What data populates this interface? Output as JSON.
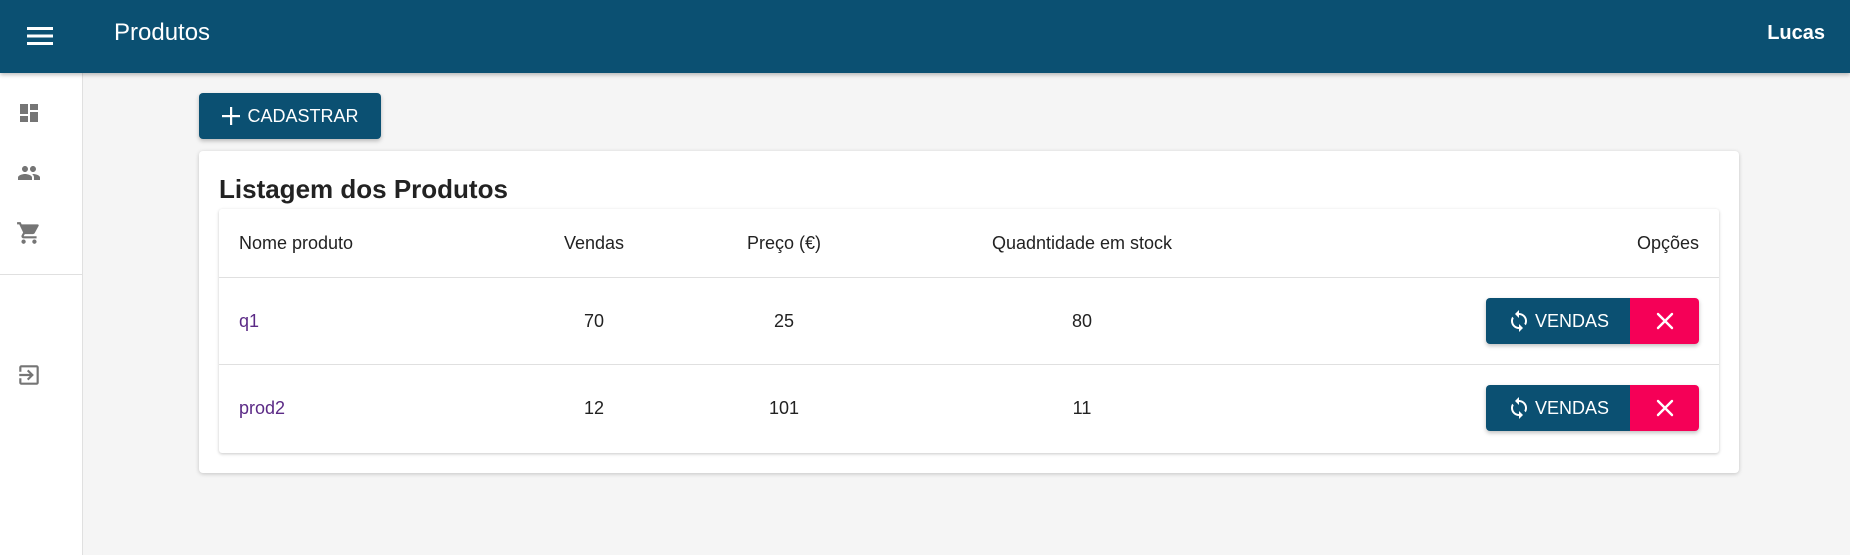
{
  "appbar": {
    "title": "Produtos",
    "user": "Lucas",
    "menu_icon": "menu-icon",
    "color": "#0b5072"
  },
  "sidebar": {
    "items": [
      {
        "icon": "dashboard-icon"
      },
      {
        "icon": "people-icon"
      },
      {
        "icon": "cart-icon"
      },
      {
        "icon": "exit-icon"
      }
    ]
  },
  "actions": {
    "add_label": "CADASTRAR",
    "add_icon": "plus-icon"
  },
  "card": {
    "title": "Listagem dos Produtos"
  },
  "table": {
    "headers": {
      "name": "Nome produto",
      "vendas": "Vendas",
      "preco": "Preço (€)",
      "stock": "Quadntidade em stock",
      "opcoes": "Opções"
    },
    "rows": [
      {
        "name": "q1",
        "vendas": "70",
        "preco": "25",
        "stock": "80",
        "vendas_btn": "VENDAS"
      },
      {
        "name": "prod2",
        "vendas": "12",
        "preco": "101",
        "stock": "11",
        "vendas_btn": "VENDAS"
      }
    ]
  },
  "colors": {
    "primary": "#0b5072",
    "danger": "#f50057",
    "link": "#5b2a86"
  }
}
